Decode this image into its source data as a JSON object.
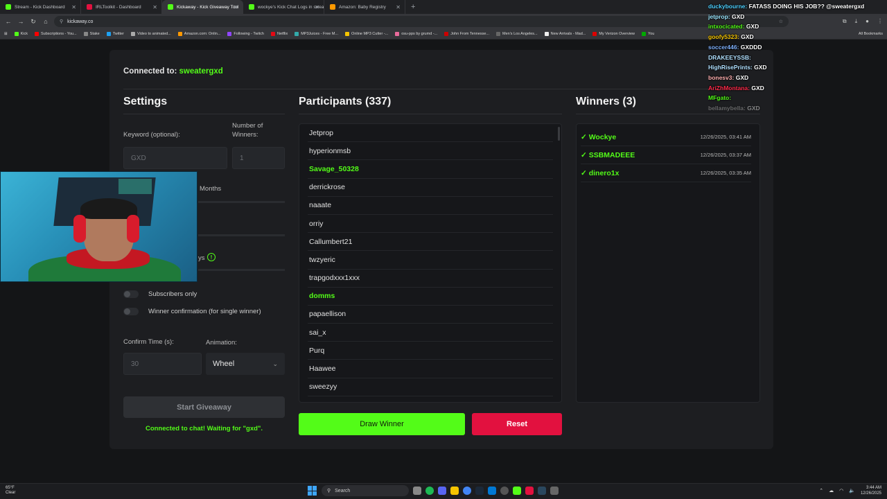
{
  "browser": {
    "tabs": [
      {
        "title": "Stream - Kick Dashboard",
        "active": false,
        "favicon_color": "#53fc18"
      },
      {
        "title": "IRLToolkit - Dashboard",
        "active": false,
        "favicon_color": "#e2113f"
      },
      {
        "title": "Kickaway - Kick Giveaway Tool",
        "active": true,
        "favicon_color": "#53fc18"
      },
      {
        "title": "wockye's Kick Chat Logs in sweatergxd's",
        "active": false,
        "favicon_color": "#53fc18"
      },
      {
        "title": "Amazon: Baby Registry",
        "active": false,
        "favicon_color": "#ff9900"
      }
    ],
    "new_tab": "+",
    "url": "kickaway.co",
    "bookmarks": [
      "Kick",
      "Subscriptions - You...",
      "Stake",
      "Twitter",
      "Video to animated...",
      "Amazon.com: Onlin...",
      "Following - Twitch",
      "Netflix",
      "MP3Juices - Free M...",
      "Online MP3 Cutter -...",
      "osu-pps by grumd -...",
      "John From Tennesse...",
      "Men's Los Angeles...",
      "New Arrivals - Mad...",
      "My Verizon Overview",
      "You"
    ],
    "all_bookmarks": "All Bookmarks"
  },
  "app": {
    "connected_label": "Connected to:",
    "connected_user": "sweatergxd",
    "settings": {
      "title": "Settings",
      "keyword_label": "Keyword (optional):",
      "keyword_value": "GXD",
      "winners_label_1": "Number of",
      "winners_label_2": "Winners:",
      "winners_value": "1",
      "months_label": "Months",
      "days_fragment": "ys",
      "subscribers_only": "Subscribers only",
      "winner_confirmation": "Winner confirmation (for single winner)",
      "confirm_time_label": "Confirm Time (s):",
      "confirm_time_value": "30",
      "animation_label": "Animation:",
      "animation_value": "Wheel",
      "start_button": "Start Giveaway",
      "status": "Connected to chat! Waiting for \"gxd\"."
    },
    "participants": {
      "title": "Participants (337)",
      "items": [
        {
          "name": "Jetprop",
          "highlight": false
        },
        {
          "name": "hyperionmsb",
          "highlight": false
        },
        {
          "name": "Savage_50328",
          "highlight": true
        },
        {
          "name": "derrickrose",
          "highlight": false
        },
        {
          "name": "naaate",
          "highlight": false
        },
        {
          "name": "orriy",
          "highlight": false
        },
        {
          "name": "Callumbert21",
          "highlight": false
        },
        {
          "name": "twzyeric",
          "highlight": false
        },
        {
          "name": "trapgodxxx1xxx",
          "highlight": false
        },
        {
          "name": "domms",
          "highlight": true
        },
        {
          "name": "papaellison",
          "highlight": false
        },
        {
          "name": "sai_x",
          "highlight": false
        },
        {
          "name": "Purq",
          "highlight": false
        },
        {
          "name": "Haawee",
          "highlight": false
        },
        {
          "name": "sweezyy",
          "highlight": false
        }
      ],
      "draw_button": "Draw Winner",
      "reset_button": "Reset"
    },
    "winners": {
      "title": "Winners (3)",
      "items": [
        {
          "name": "✓ Wockye",
          "time": "12/26/2025, 03:41 AM"
        },
        {
          "name": "✓ SSBMADEEE",
          "time": "12/26/2025, 03:37 AM"
        },
        {
          "name": "✓ dinero1x",
          "time": "12/26/2025, 03:35 AM"
        }
      ]
    }
  },
  "chat": [
    {
      "user": "duckybourne:",
      "text": "FATASS DOING HIS JOB?? @sweatergxd",
      "color": "#4dd0ff",
      "fade": false
    },
    {
      "user": "jetprop:",
      "text": "GXD",
      "color": "#9be7ff",
      "fade": false
    },
    {
      "user": "intxocicated:",
      "text": "GXD",
      "color": "#53fc18",
      "fade": false
    },
    {
      "user": "goofy5323:",
      "text": "GXD",
      "color": "#f5c400",
      "fade": false
    },
    {
      "user": "soccer446:",
      "text": "GXDDD",
      "color": "#7fb2ff",
      "fade": false
    },
    {
      "user": "DRAKEEYSSB:",
      "text": "",
      "color": "#b0e0ff",
      "fade": false
    },
    {
      "user": "HighRisePrints:",
      "text": "GXD",
      "color": "#b0e0ff",
      "fade": false
    },
    {
      "user": "bonesv3:",
      "text": "GXD",
      "color": "#ffb0b0",
      "fade": false
    },
    {
      "user": "AriZhMontana:",
      "text": "GXD",
      "color": "#ff2a4a",
      "fade": false
    },
    {
      "user": "MFgato:",
      "text": "",
      "color": "#53fc18",
      "fade": false
    },
    {
      "user": "bellamybella:",
      "text": "GXD",
      "color": "#c0c0c0",
      "fade": true
    }
  ],
  "taskbar": {
    "temp": "65°F",
    "condition": "Clear",
    "search": "Search",
    "time": "3:44 AM",
    "date": "12/26/2025"
  }
}
